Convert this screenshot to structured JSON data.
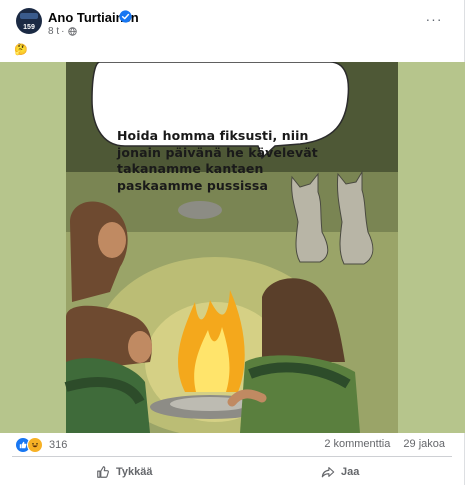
{
  "post": {
    "author": "Ano Turtiainen",
    "avatar_text": "159",
    "timestamp": "8 t",
    "separator": "·",
    "body_emoji": "🤔",
    "more_label": "···"
  },
  "image": {
    "caption_lines": [
      "Hoida homma fiksusti, niin",
      "jonain päivänä he kävelevät",
      "takanamme kantaen",
      "paskaamme pussissa"
    ]
  },
  "footer": {
    "reaction_count": "316",
    "comments": "2 kommenttia",
    "shares": "29 jakoa",
    "like_label": "Tykkää",
    "share_label": "Jaa"
  },
  "colors": {
    "brand": "#1877f2",
    "text_secondary": "#65676b",
    "bubble": "#ffffff",
    "scene_ground": "#b7c58e"
  },
  "icons": [
    "verified-badge-icon",
    "globe-icon",
    "more-icon",
    "like-reaction-icon",
    "haha-reaction-icon",
    "thumbs-up-icon",
    "share-arrow-icon"
  ]
}
